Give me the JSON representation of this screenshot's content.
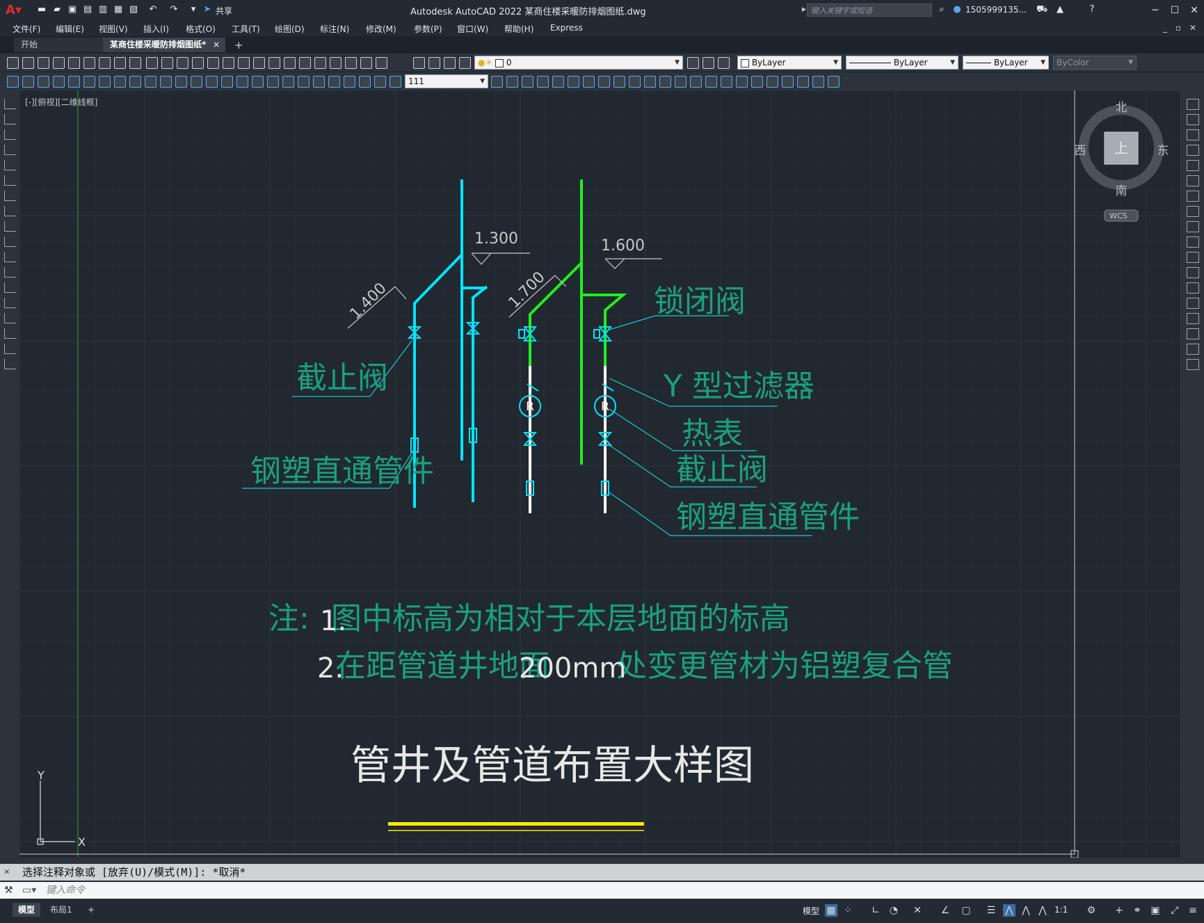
{
  "app": {
    "title": "Autodesk AutoCAD 2022    某商住楼采暖防排烟图纸.dwg",
    "search_placeholder": "键入关键字或短语",
    "user": "1505999135...",
    "share": "共享"
  },
  "menu": [
    "文件(F)",
    "编辑(E)",
    "视图(V)",
    "插入(I)",
    "格式(O)",
    "工具(T)",
    "绘图(D)",
    "标注(N)",
    "修改(M)",
    "参数(P)",
    "窗口(W)",
    "帮助(H)",
    "Express"
  ],
  "tabs": {
    "start": "开始",
    "document": "某商住楼采暖防排烟图纸*",
    "close": "×",
    "add": "+"
  },
  "properties": {
    "layer": "0",
    "color": "ByLayer",
    "linetype": "ByLayer",
    "lineweight": "ByLayer",
    "plotstyle": "ByColor",
    "dimstyle": "111"
  },
  "viewport": {
    "label": "[-][俯视][二维线框]"
  },
  "viewcube": {
    "north": "北",
    "south": "南",
    "east": "东",
    "west": "西",
    "face": "上",
    "wcs": "WCS"
  },
  "drawing": {
    "elev_1300": "1.300",
    "elev_1600": "1.600",
    "dim_1400": "1.400",
    "dim_1700": "1.700",
    "label_stop_valve_left": "截止阀",
    "label_fitting_left": "钢塑直通管件",
    "label_lock_valve": "锁闭阀",
    "label_y_filter": "Y 型过滤器",
    "label_heat_meter": "热表",
    "label_stop_valve_right": "截止阀",
    "label_fitting_right": "钢塑直通管件",
    "note_prefix": "注:",
    "note_1_num": "1.",
    "note_1": "图中标高为相对于本层地面的标高",
    "note_2_num": "2.",
    "note_2_a": "在距管道井地面",
    "note_2_dim": "200mm",
    "note_2_b": "处变更管材为铝塑复合管",
    "title": "管井及管道布置大样图",
    "meter_symbol": "R",
    "ucs_y": "Y",
    "ucs_x": "X"
  },
  "command": {
    "history": "选择注释对象或 [放弃(U)/模式(M)]: *取消*",
    "placeholder": "键入命令"
  },
  "status": {
    "model_tab": "模型",
    "layout_tab": "布局1",
    "add": "+",
    "model_space": "模型",
    "scale": "1:1"
  }
}
